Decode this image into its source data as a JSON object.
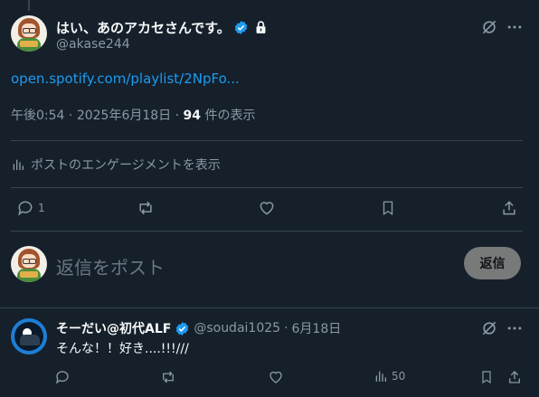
{
  "tweet": {
    "display_name": "はい、あのアカセさんです。",
    "handle": "@akase244",
    "link_text": "open.spotify.com/playlist/2NpFo...",
    "time": "午後0:54",
    "sep": "·",
    "date": "2025年6月18日",
    "views_count": "94",
    "views_label": "件の表示",
    "activity_label": "ポストのエンゲージメントを表示",
    "reply_count": "1"
  },
  "composer": {
    "placeholder": "返信をポスト",
    "button_label": "返信"
  },
  "reply": {
    "display_name": "そーだい@初代ALF",
    "handle": "@soudai1025",
    "sep": "·",
    "date": "6月18日",
    "text": "そんな！！好き....!!!///",
    "views_count": "50"
  },
  "colors": {
    "background": "#15202b",
    "accent": "#1d9bf0",
    "verified": "#1d9bf0",
    "muted": "#8b98a5",
    "divider": "#38444d"
  }
}
